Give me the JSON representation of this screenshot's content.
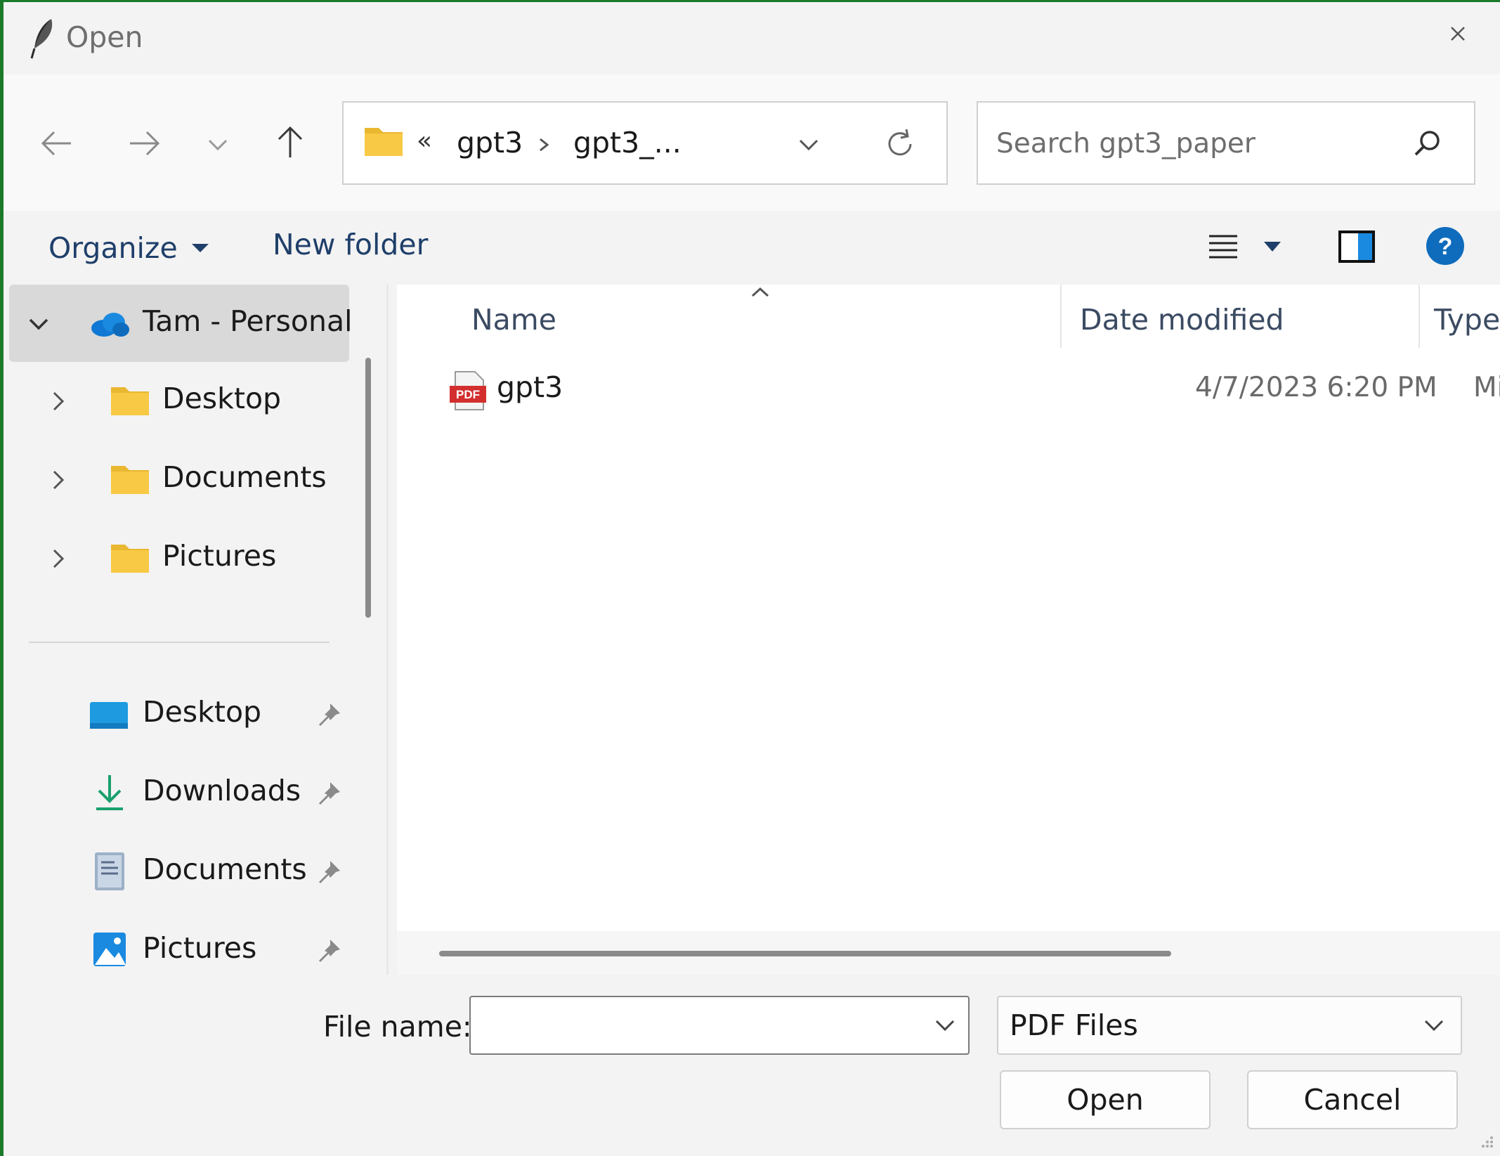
{
  "window": {
    "title": "Open",
    "icon": "feather-icon"
  },
  "navigation": {
    "back_icon": "arrow-left-icon",
    "forward_icon": "arrow-right-icon",
    "recent_icon": "chevron-down-icon",
    "up_icon": "arrow-up-icon"
  },
  "address_bar": {
    "overflow_glyph": "«",
    "segments": [
      "gpt3",
      "gpt3_..."
    ],
    "separator_icon": "chevron-right-icon"
  },
  "search": {
    "placeholder": "Search gpt3_paper",
    "value": ""
  },
  "command_bar": {
    "organize_label": "Organize",
    "new_folder_label": "New folder"
  },
  "nav_pane": {
    "tree": [
      {
        "label": "Tam - Personal",
        "icon": "onedrive-cloud-icon",
        "expanded": true,
        "selected": true
      },
      {
        "label": "Desktop",
        "icon": "folder-icon",
        "expanded": false
      },
      {
        "label": "Documents",
        "icon": "folder-icon",
        "expanded": false
      },
      {
        "label": "Pictures",
        "icon": "folder-icon",
        "expanded": false
      }
    ],
    "quick_access": [
      {
        "label": "Desktop",
        "icon": "desktop-icon",
        "pinned": true
      },
      {
        "label": "Downloads",
        "icon": "download-icon",
        "pinned": true
      },
      {
        "label": "Documents",
        "icon": "documents-icon",
        "pinned": true
      },
      {
        "label": "Pictures",
        "icon": "pictures-icon",
        "pinned": true
      }
    ]
  },
  "file_list": {
    "columns": [
      "Name",
      "Date modified",
      "Type"
    ],
    "sorted_by": "Name",
    "rows": [
      {
        "name": "gpt3",
        "date_modified": "4/7/2023 6:20 PM",
        "type": "Micro",
        "icon": "pdf-icon"
      }
    ]
  },
  "footer": {
    "file_name_label": "File name:",
    "file_name_value": "",
    "file_type_selected": "PDF Files",
    "open_label": "Open",
    "cancel_label": "Cancel"
  },
  "colors": {
    "window_bg": "#f3f3f3",
    "accent_blue": "#0f6cbd",
    "folder_yellow": "#f8c944",
    "pdf_red": "#d32f2f",
    "border": "#d0d0d0"
  }
}
